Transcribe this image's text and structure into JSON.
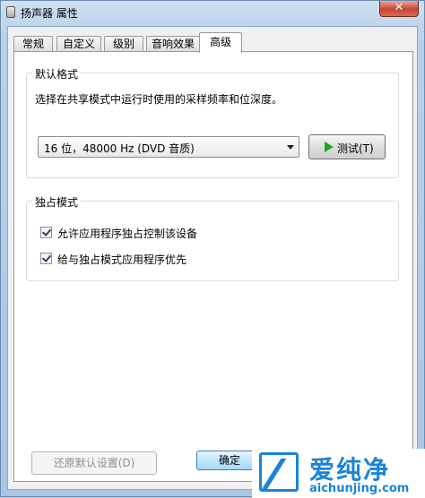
{
  "window": {
    "title": "扬声器 属性",
    "close_label": "✕"
  },
  "tabs": [
    {
      "label": "常规",
      "active": false
    },
    {
      "label": "自定义",
      "active": false
    },
    {
      "label": "级别",
      "active": false
    },
    {
      "label": "音响效果",
      "active": false
    },
    {
      "label": "高级",
      "active": true
    }
  ],
  "default_format": {
    "group_title": "默认格式",
    "description": "选择在共享模式中运行时使用的采样频率和位深度。",
    "selected_format": "16 位，48000 Hz (DVD 音质)",
    "test_button_label": "测试(T)"
  },
  "exclusive_mode": {
    "group_title": "独占模式",
    "options": [
      {
        "label": "允许应用程序独占控制该设备",
        "checked": true
      },
      {
        "label": "给与独占模式应用程序优先",
        "checked": true
      }
    ]
  },
  "restore_button_label": "还原默认设置(D)",
  "ok_button_label": "确定",
  "watermark": {
    "title": "爱纯净",
    "url": "aichunjing.com"
  }
}
